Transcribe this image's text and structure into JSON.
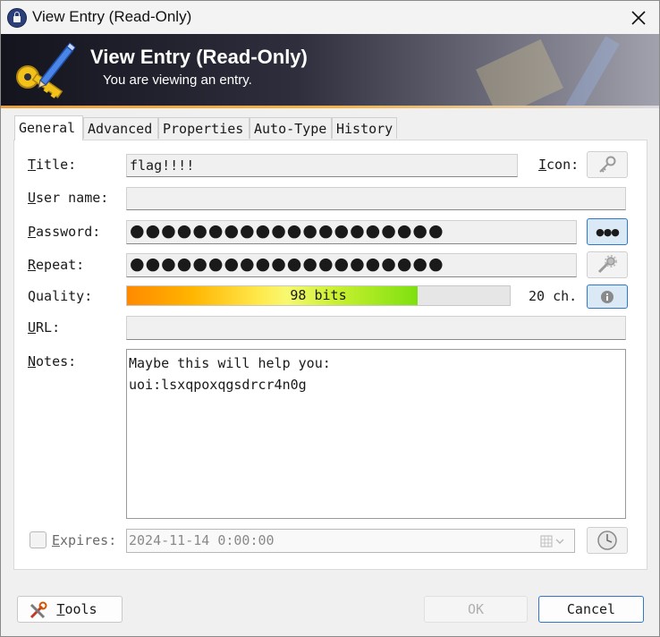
{
  "window": {
    "title": "View Entry (Read-Only)"
  },
  "banner": {
    "title": "View Entry (Read-Only)",
    "subtitle": "You are viewing an entry."
  },
  "tabs": [
    {
      "label": "General",
      "active": true
    },
    {
      "label": "Advanced",
      "active": false
    },
    {
      "label": "Properties",
      "active": false
    },
    {
      "label": "Auto-Type",
      "active": false
    },
    {
      "label": "History",
      "active": false
    }
  ],
  "form": {
    "title": {
      "label_key": "T",
      "label_rest": "itle:",
      "value": "flag!!!!"
    },
    "icon_label": {
      "key": "I",
      "rest": "con:"
    },
    "username": {
      "label_key": "U",
      "label_rest": "ser name:",
      "value": ""
    },
    "password": {
      "label_key": "P",
      "label_rest": "assword:",
      "value": "●●●●●●●●●●●●●●●●●●●●",
      "toggle_label": "●●●"
    },
    "repeat": {
      "label_key": "R",
      "label_rest": "epeat:",
      "value": "●●●●●●●●●●●●●●●●●●●●"
    },
    "quality": {
      "label": "Quality:",
      "bits_text": "98 bits",
      "fill_fraction": 0.76,
      "chars_text": "20 ch."
    },
    "url": {
      "label_key": "U",
      "label_rest": "RL:",
      "value": ""
    },
    "notes": {
      "label_key": "N",
      "label_rest": "otes:",
      "lines": [
        "Maybe this will help you:",
        "uoi:lsxqpoxqgsdrcr4n0g"
      ]
    },
    "expires": {
      "label_key": "E",
      "label_rest": "xpires:",
      "checked": false,
      "value": "2024-11-14  0:00:00"
    }
  },
  "footer": {
    "tools": {
      "key": "T",
      "rest": "ools"
    },
    "ok_label": "OK",
    "cancel_label": "Cancel"
  },
  "colors": {
    "accent": "#2f77c9",
    "banner_dark": "#14141e",
    "banner_line": "#f3b24a"
  },
  "icons": [
    "keepass-lock-icon",
    "close-icon",
    "key-pen-icon",
    "key-icon",
    "dots-icon",
    "gear-icon",
    "info-icon",
    "calendar-icon",
    "clock-icon",
    "tools-icon"
  ]
}
